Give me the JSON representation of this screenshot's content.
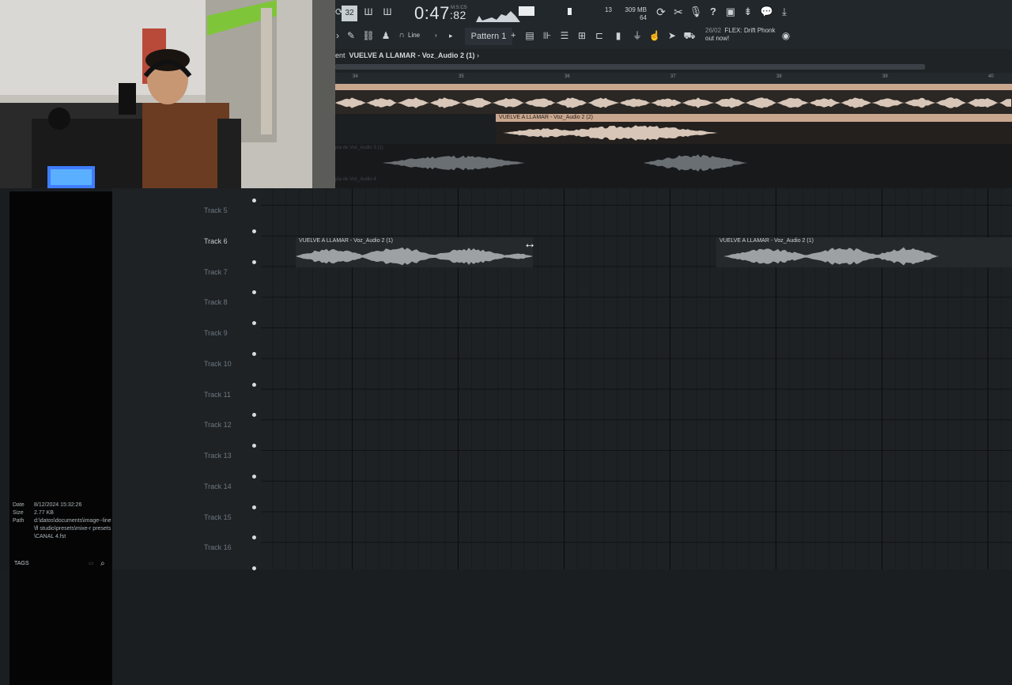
{
  "toolbar": {
    "time": "0:47",
    "time_frac": ":82",
    "time_unit": "M:S:CS",
    "snap_label": "Line",
    "pattern": "Pattern 1",
    "cpu_num": "13",
    "mem_mb": "309 MB",
    "mem_poly": "64",
    "news_date": "26/02",
    "news_text": "FLEX: Drift Phonk",
    "news_sub": "out now!",
    "icons": [
      "typing-keyboard-icon",
      "step-icon",
      "pattern-song-icon",
      "metronome-icon",
      "record-icon",
      "undo-icon",
      "cut-icon",
      "mic-icon",
      "help-icon",
      "save-icon",
      "mixer-icon",
      "chat-icon",
      "download-icon"
    ]
  },
  "breadcrumb": {
    "prefix": "ent",
    "label": "VUELVE A LLAMAR - Voz_Audio 2 (1)",
    "arrow": "›"
  },
  "ruler": [
    "34",
    "35",
    "36",
    "37",
    "38",
    "39",
    "40"
  ],
  "top_lanes": {
    "clip2_label": "VUELVE A LLAMAR - Voz_Audio 2 (2)",
    "ghost3": "pia de Voz_Audio 3 (1)",
    "ghost4": "pia de Voz_Audio 4"
  },
  "tracks": [
    "Track 5",
    "Track 6",
    "Track 7",
    "Track 8",
    "Track 9",
    "Track 10",
    "Track 11",
    "Track 12",
    "Track 13",
    "Track 14",
    "Track 15",
    "Track 16"
  ],
  "clips": [
    {
      "label": "VUELVE A LLAMAR - Voz_Audio 2 (1)"
    },
    {
      "label": "VUELVE A LLAMAR - Voz_Audio 2 (1)"
    }
  ],
  "browser": {
    "date_k": "Date",
    "date_v": "8/12/2024 15:32:26",
    "size_k": "Size",
    "size_v": "2.77 KB",
    "path_k": "Path",
    "path_v": "d:\\datos\\documents\\image--line\\fl studio\\presets\\mixe-r presets\\CANAL 4.fst",
    "tags": "TAGS"
  }
}
